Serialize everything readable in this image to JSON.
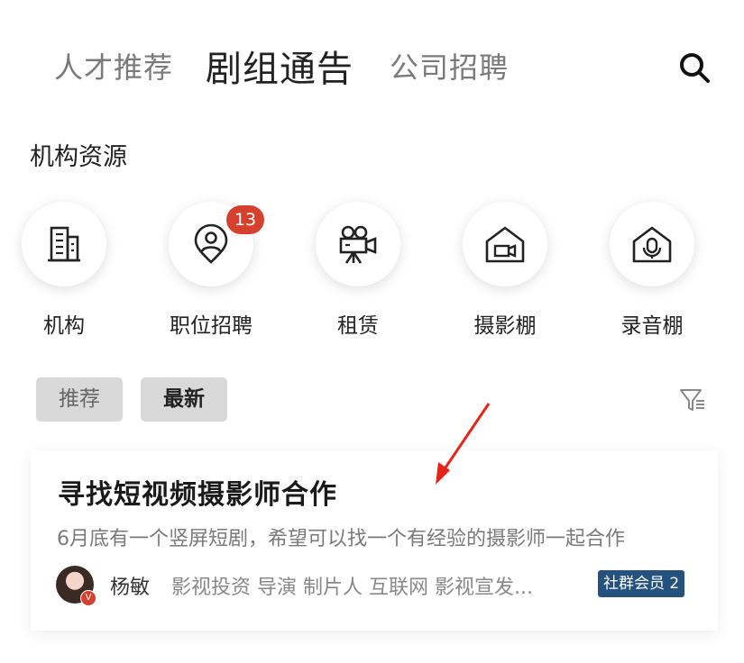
{
  "tabs": [
    {
      "label": "人才推荐",
      "active": false
    },
    {
      "label": "剧组通告",
      "active": true
    },
    {
      "label": "公司招聘",
      "active": false
    }
  ],
  "section_title": "机构资源",
  "resources": [
    {
      "label": "机构",
      "icon": "building-icon"
    },
    {
      "label": "职位招聘",
      "icon": "location-person-icon",
      "badge": "13"
    },
    {
      "label": "租赁",
      "icon": "movie-camera-icon"
    },
    {
      "label": "摄影棚",
      "icon": "studio-camera-icon"
    },
    {
      "label": "录音棚",
      "icon": "studio-mic-icon"
    }
  ],
  "filters": [
    {
      "label": "推荐"
    },
    {
      "label": "最新"
    }
  ],
  "post": {
    "title": "寻找短视频摄影师合作",
    "description": "6月底有一个竖屏短剧，希望可以找一个有经验的摄影师一起合作",
    "author": "杨敏",
    "tags": "影视投资 导演 制片人 互联网 影视宣发...",
    "member_badge": "社群会员 2",
    "avatar_badge": "V"
  },
  "colors": {
    "badge": "#d6402e",
    "member": "#24517d",
    "arrow": "#e8231a"
  }
}
